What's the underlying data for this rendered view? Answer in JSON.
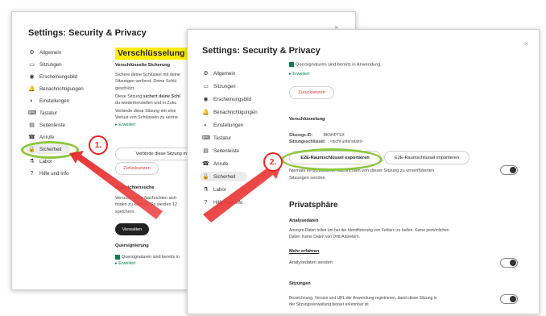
{
  "windowA": {
    "title": "Settings: Security & Privacy",
    "close": "×",
    "sidebar": [
      {
        "icon": "⚙",
        "label": "Allgemein"
      },
      {
        "icon": "▭",
        "label": "Sitzungen"
      },
      {
        "icon": "◉",
        "label": "Erscheinungsbild"
      },
      {
        "icon": "🔔",
        "label": "Benachrichtigungen"
      },
      {
        "icon": "◐",
        "label": "Einstellungen"
      },
      {
        "icon": "⌨",
        "label": "Tastatur"
      },
      {
        "icon": "▤",
        "label": "Seitenleiste"
      },
      {
        "icon": "☎",
        "label": "Anrufe"
      },
      {
        "icon": "🔒",
        "label": "Sicherheit"
      },
      {
        "icon": "⚗",
        "label": "Labor"
      },
      {
        "icon": "?",
        "label": "Hilfe und Info"
      }
    ],
    "heading": "Verschlüsselung",
    "sub1": "Verschlüsselte Sicherung",
    "para1a": "Sichere deine Schlüssel mit deine",
    "para1b": "Sitzungen verlierst. Deine Schlü",
    "para1c": "geschützt.",
    "para2a_pre": "Diese Sitzung ",
    "para2a_bold": "sichert deine Schl",
    "para2b": "du wiederherstellen und in Zuku",
    "para3a": "Verbinde diese Sitzung mit eine",
    "para3b": "Verlust von Schlüsseln zu verme",
    "advanced": "▸ Erweitert",
    "btn_connect": "Verbinde diese Sitzung mit e",
    "btn_reset": "Zurücksetzen",
    "sub2": "Nachrichtensuche",
    "para4a": "Verschlüsselte Nachrichten sich",
    "para4b": "finden zu können. Es werden 12",
    "para4c": "speichern.",
    "btn_manage": "Verwalten",
    "sub3": "Quersignierung",
    "cross1": "Quersignaturen sind bereits in",
    "advanced2": "▸ Erweitert"
  },
  "windowB": {
    "title": "Settings: Security & Privacy",
    "close": "×",
    "sidebar": [
      {
        "icon": "⚙",
        "label": "Allgemein"
      },
      {
        "icon": "▭",
        "label": "Sitzungen"
      },
      {
        "icon": "◉",
        "label": "Erscheinungsbild"
      },
      {
        "icon": "🔔",
        "label": "Benachrichtigungen"
      },
      {
        "icon": "◐",
        "label": "Einstellungen"
      },
      {
        "icon": "⌨",
        "label": "Tastatur"
      },
      {
        "icon": "▤",
        "label": "Seitenleiste"
      },
      {
        "icon": "☎",
        "label": "Anrufe"
      },
      {
        "icon": "🔒",
        "label": "Sicherheit"
      },
      {
        "icon": "⚗",
        "label": "Labor"
      },
      {
        "icon": "?",
        "label": "Hilfe und Info"
      }
    ],
    "cross_top": "Quersignaturen sind bereits in Anwendung.",
    "advanced": "▸ Erweitert",
    "btn_reset": "Zurücksetzen",
    "sub_enc": "Verschlüsselung",
    "session_id_label": "Sitzungs-ID:",
    "session_id_value": "BK5HPTSX",
    "session_key_label": "Sitzungsschlüssel:",
    "session_key_value": "<nicht unterstützt>",
    "btn_export": "E2E-Raumschlüssel exportieren",
    "btn_import": "E2E-Raumschlüssel importieren",
    "never_line1": "Niemals verschlüsselte Nachrichten von dieser Sitzung zu unverifizierten",
    "never_line2": "Sitzungen senden",
    "privacy_heading": "Privatsphäre",
    "analytics_h": "Analysedaten",
    "analytics_p1": "Anonym Daten teilen um bei der Identifizierung von Fehlern zu helfen. Keine persönlichen",
    "analytics_p2": "Daten. Keine Daten von Dritt-Anbietern.",
    "more_info": "Mehr erfahren",
    "send_analytics": "Analysedaten senden",
    "sessions_h": "Sitzungen",
    "sessions_p1": "Bezeichnung, Version und URL der Anwendung registrieren, damit diese Sitzung in",
    "sessions_p2": "der Sitzungsverwaltung besser erkennbar ist"
  },
  "annotations": {
    "step1": "1.",
    "step2": "2."
  }
}
